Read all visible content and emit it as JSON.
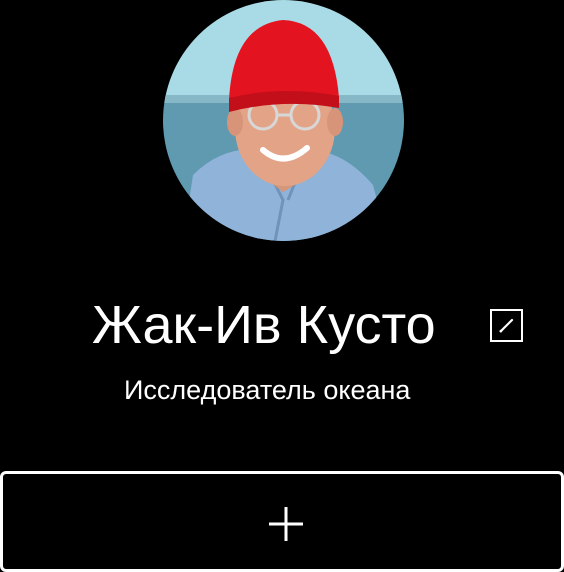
{
  "profile": {
    "photo_icon": "profile-photo",
    "name": "Жак-Ив Кусто",
    "subtitle": "Исследователь океана",
    "edit_icon": "pencil-icon"
  },
  "actions": {
    "add_icon": "plus-icon"
  },
  "colors": {
    "background": "#000000",
    "foreground": "#ffffff",
    "hat": "#e3131f",
    "shirt": "#8fb3d9",
    "sky": "#a9dbe6",
    "sea": "#5f9ab0"
  }
}
